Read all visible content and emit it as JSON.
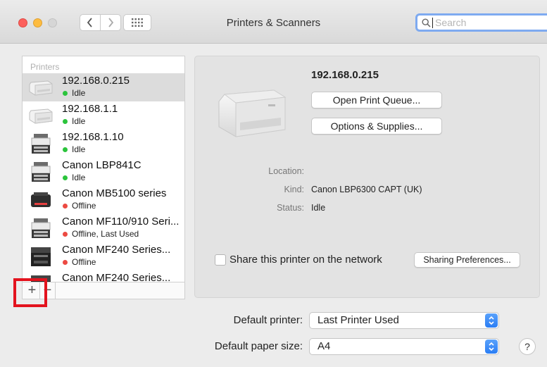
{
  "window": {
    "title": "Printers & Scanners"
  },
  "search": {
    "placeholder": "Search"
  },
  "printers": {
    "header": "Printers",
    "items": [
      {
        "name": "192.168.0.215",
        "status": "Idle",
        "status_color": "green",
        "icon": "printer-laser-icon"
      },
      {
        "name": "192.168.1.1",
        "status": "Idle",
        "status_color": "green",
        "icon": "printer-laser-icon"
      },
      {
        "name": "192.168.1.10",
        "status": "Idle",
        "status_color": "green",
        "icon": "printer-mfp-icon"
      },
      {
        "name": "Canon LBP841C",
        "status": "Idle",
        "status_color": "green",
        "icon": "printer-mfp-icon"
      },
      {
        "name": "Canon MB5100 series",
        "status": "Offline",
        "status_color": "red",
        "icon": "printer-inkjet-icon"
      },
      {
        "name": "Canon MF110/910 Seri...",
        "status": "Offline, Last Used",
        "status_color": "red",
        "icon": "printer-mfp-icon"
      },
      {
        "name": "Canon MF240 Series...",
        "status": "Offline",
        "status_color": "red",
        "icon": "printer-mfp-dark-icon"
      },
      {
        "name": "Canon MF240 Series...",
        "status": "",
        "status_color": "red",
        "icon": "printer-mfp-dark-icon"
      }
    ],
    "add_label": "+",
    "remove_label": "−"
  },
  "detail": {
    "printer_name": "192.168.0.215",
    "open_queue_label": "Open Print Queue...",
    "options_label": "Options & Supplies...",
    "location_label": "Location:",
    "location_value": "",
    "kind_label": "Kind:",
    "kind_value": "Canon LBP6300 CAPT (UK)",
    "status_label": "Status:",
    "status_value": "Idle",
    "share_label": "Share this printer on the network",
    "sharing_prefs_label": "Sharing Preferences..."
  },
  "defaults": {
    "printer_label": "Default printer:",
    "printer_value": "Last Printer Used",
    "paper_label": "Default paper size:",
    "paper_value": "A4"
  },
  "help_label": "?",
  "colors": {
    "highlight": "#e3131e",
    "status_green": "#2bc43c",
    "status_red": "#ec4a42",
    "search_focus": "#7eaaf0",
    "select_accent": "#2a7df4"
  }
}
